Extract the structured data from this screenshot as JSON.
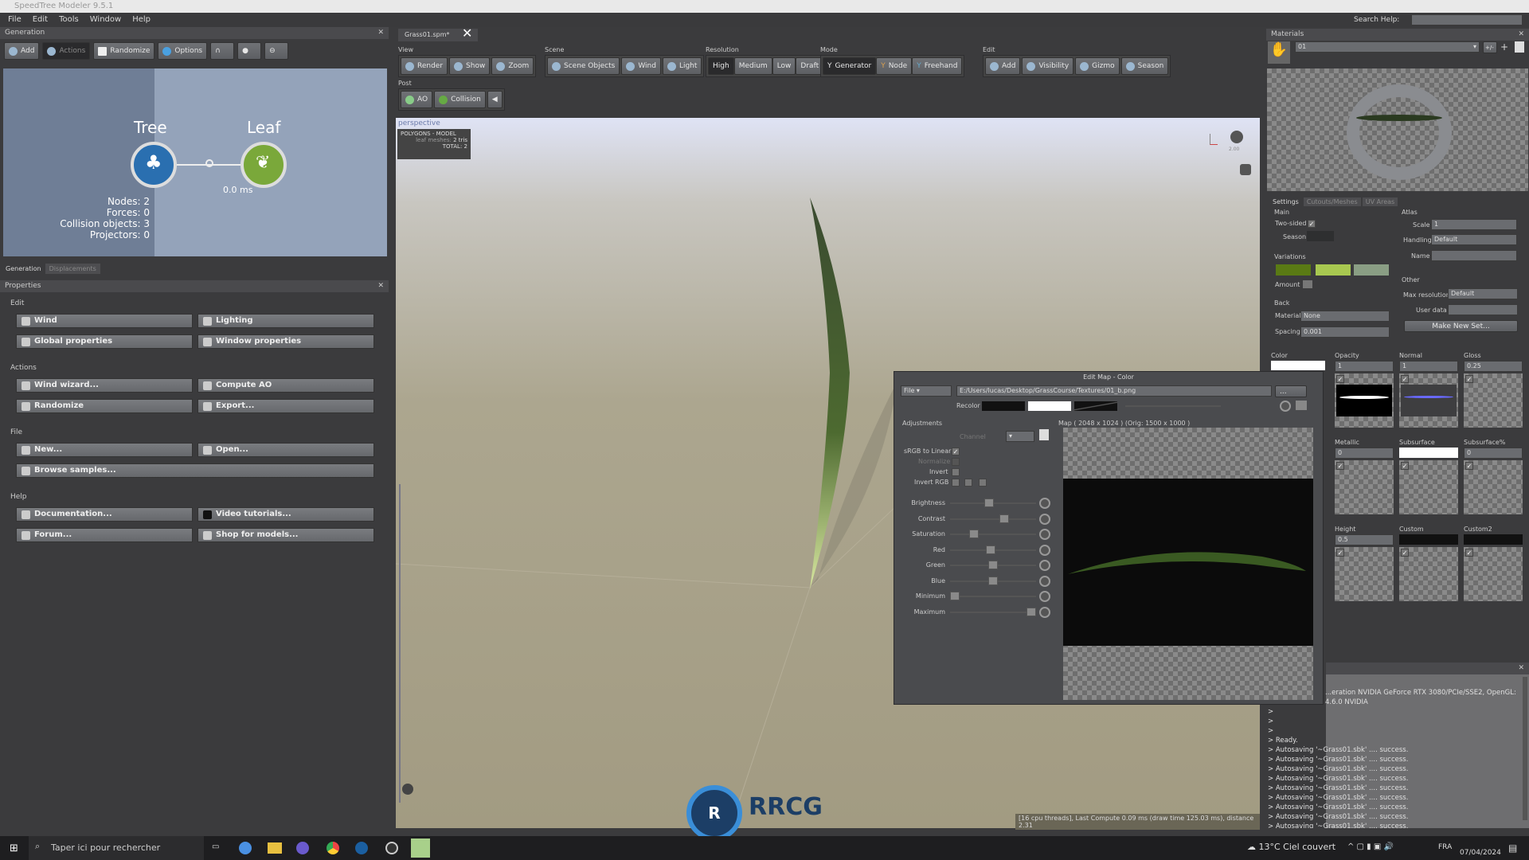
{
  "app": {
    "title": "SpeedTree Modeler 9.5.1",
    "menu": [
      "File",
      "Edit",
      "Tools",
      "Window",
      "Help"
    ],
    "search_help": "Search Help:"
  },
  "generation": {
    "title": "Generation",
    "toolbar": [
      "Add",
      "Actions",
      "Randomize",
      "Options"
    ],
    "nodes": {
      "tree": "Tree",
      "leaf": "Leaf",
      "time": "0.0 ms"
    },
    "stats": [
      "Nodes: 2",
      "Forces: 0",
      "Collision objects: 3",
      "Projectors: 0"
    ],
    "tabs": [
      "Generation",
      "Displacements"
    ]
  },
  "properties": {
    "title": "Properties",
    "sections": [
      {
        "label": "Edit",
        "buttons": [
          "Wind",
          "Lighting",
          "Global properties",
          "Window properties"
        ]
      },
      {
        "label": "Actions",
        "buttons": [
          "Wind wizard...",
          "Compute AO",
          "Randomize",
          "Export..."
        ]
      },
      {
        "label": "File",
        "buttons": [
          "New...",
          "Open...",
          "Browse samples..."
        ]
      },
      {
        "label": "Help",
        "buttons": [
          "Documentation...",
          "Video tutorials...",
          "Forum...",
          "Shop for models..."
        ]
      }
    ]
  },
  "document_tab": "Grass01.spm*",
  "toolbar": {
    "view": {
      "label": "View",
      "buttons": [
        "Render",
        "Show",
        "Zoom"
      ]
    },
    "scene": {
      "label": "Scene",
      "buttons": [
        "Scene Objects",
        "Wind",
        "Light"
      ]
    },
    "resolution": {
      "label": "Resolution",
      "buttons": [
        "High",
        "Medium",
        "Low",
        "Draft"
      ],
      "selected": "High"
    },
    "mode": {
      "label": "Mode",
      "buttons": [
        "Generator",
        "Node",
        "Freehand"
      ],
      "selected": "Generator"
    },
    "edit": {
      "label": "Edit",
      "buttons": [
        "Add",
        "Visibility",
        "Gizmo",
        "Season"
      ]
    },
    "post": {
      "label": "Post",
      "buttons": [
        "AO",
        "Collision"
      ]
    }
  },
  "viewport": {
    "label": "perspective",
    "overlay_title": "POLYGONS - MODEL",
    "overlay_leaf": "leaf meshes:",
    "overlay_leaf_val": "2 tris",
    "overlay_total": "TOTAL: 2",
    "zoom_val": "2.00",
    "status": "[16 cpu threads], Last Compute 0.09 ms (draw time 125.03 ms), distance 2.31"
  },
  "edit_map": {
    "title": "Edit Map - Color",
    "source": "File",
    "path": "E:/Users/lucas/Desktop/GrassCourse/Textures/01_b.png",
    "browse": "...",
    "recolor": "Recolor",
    "adjustments": "Adjustments",
    "map_info": "Map  ( 2048 x 1024 ) (Orig: 1500 x 1000 )",
    "channel": "Channel",
    "srgb": "sRGB to Linear",
    "normalize": "Normalize",
    "invert": "Invert",
    "invert_rgb": "Invert RGB",
    "sliders": [
      {
        "label": "Brightness",
        "value": 0.45
      },
      {
        "label": "Contrast",
        "value": 0.65
      },
      {
        "label": "Saturation",
        "value": 0.25
      },
      {
        "label": "Red",
        "value": 0.47
      },
      {
        "label": "Green",
        "value": 0.5
      },
      {
        "label": "Blue",
        "value": 0.5
      },
      {
        "label": "Minimum",
        "value": 0.0
      },
      {
        "label": "Maximum",
        "value": 1.0
      }
    ]
  },
  "materials": {
    "title": "Materials",
    "selected": "01",
    "pm": "+/-",
    "tabs": [
      "Settings",
      "Cutouts/Meshes",
      "UV Areas"
    ],
    "main": "Main",
    "two_sided": "Two-sided",
    "season": "Season",
    "variations": "Variations",
    "variation_colors": [
      "#5a7a14",
      "#a8c850",
      "#8a9e84"
    ],
    "amount": "Amount",
    "back": "Back",
    "material_lbl": "Material",
    "material_val": "None",
    "spacing_lbl": "Spacing",
    "spacing_val": "0.001",
    "atlas": "Atlas",
    "scale_lbl": "Scale",
    "scale_val": "1",
    "handling_lbl": "Handling",
    "handling_val": "Default",
    "name_lbl": "Name",
    "other": "Other",
    "maxres_lbl": "Max resolution",
    "maxres_val": "Default",
    "userdata_lbl": "User data",
    "make_set": "Make New Set...",
    "maps": [
      {
        "label": "Color",
        "value": ""
      },
      {
        "label": "Opacity",
        "value": "1"
      },
      {
        "label": "Normal",
        "value": "1"
      },
      {
        "label": "Gloss",
        "value": "0.25"
      },
      {
        "label": "Metallic",
        "value": "0"
      },
      {
        "label": "Subsurface",
        "value": ""
      },
      {
        "label": "Subsurface%",
        "value": "0"
      },
      {
        "label": "Height",
        "value": "0.5"
      },
      {
        "label": "Custom",
        "value": ""
      },
      {
        "label": "Custom2",
        "value": ""
      }
    ]
  },
  "console": {
    "gpu": "...eration NVIDIA GeForce RTX 3080/PCIe/SSE2, OpenGL: 4.6.0 NVIDIA",
    "lines": [
      ">",
      ">",
      ">",
      ">  Ready.",
      "> Autosaving '~Grass01.sbk' .... success.",
      "> Autosaving '~Grass01.sbk' .... success.",
      "> Autosaving '~Grass01.sbk' .... success.",
      "> Autosaving '~Grass01.sbk' .... success.",
      "> Autosaving '~Grass01.sbk' .... success.",
      "> Autosaving '~Grass01.sbk' .... success.",
      "> Autosaving '~Grass01.sbk' .... success.",
      "> Autosaving '~Grass01.sbk' .... success.",
      "> Autosaving '~Grass01.sbk' .... success.",
      "> Autosaving '~Grass01.sbk' .... success.",
      "> Autosaving '~Grass01.sbk' .... success.",
      "> Autosaving '~Grass01.sbk' .... success."
    ]
  },
  "taskbar": {
    "search": "Taper ici pour rechercher",
    "weather": "13°C  Ciel couvert",
    "lang": "FRA",
    "date": "07/04/2024"
  },
  "watermark": "RRCG 人人素材"
}
